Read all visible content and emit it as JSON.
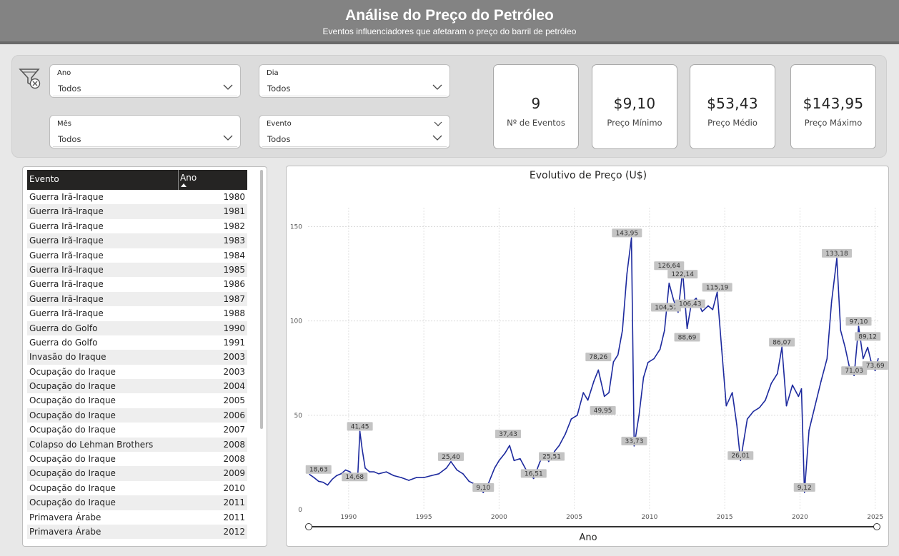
{
  "header": {
    "title": "Análise do Preço do Petróleo",
    "subtitle": "Eventos influenciadores que afetaram o preço do barril de petróleo"
  },
  "filters": {
    "ano": {
      "label": "Ano",
      "value": "Todos"
    },
    "dia": {
      "label": "Dia",
      "value": "Todos"
    },
    "mes": {
      "label": "Mês",
      "value": "Todos"
    },
    "evento": {
      "label": "Evento",
      "value": "Todos"
    }
  },
  "cards": [
    {
      "value": "9",
      "caption": "Nº de Eventos"
    },
    {
      "value": "$9,10",
      "caption": "Preço Mínimo"
    },
    {
      "value": "$53,43",
      "caption": "Preço Médio"
    },
    {
      "value": "$143,95",
      "caption": "Preço Máximo"
    }
  ],
  "table": {
    "headers": [
      "Evento",
      "Ano"
    ],
    "rows": [
      [
        "Guerra Irã-Iraque",
        "1980"
      ],
      [
        "Guerra Irã-Iraque",
        "1981"
      ],
      [
        "Guerra Irã-Iraque",
        "1982"
      ],
      [
        "Guerra Irã-Iraque",
        "1983"
      ],
      [
        "Guerra Irã-Iraque",
        "1984"
      ],
      [
        "Guerra Irã-Iraque",
        "1985"
      ],
      [
        "Guerra Irã-Iraque",
        "1986"
      ],
      [
        "Guerra Irã-Iraque",
        "1987"
      ],
      [
        "Guerra Irã-Iraque",
        "1988"
      ],
      [
        "Guerra do Golfo",
        "1990"
      ],
      [
        "Guerra do Golfo",
        "1991"
      ],
      [
        "Invasão do Iraque",
        "2003"
      ],
      [
        "Ocupação do Iraque",
        "2003"
      ],
      [
        "Ocupação do Iraque",
        "2004"
      ],
      [
        "Ocupação do Iraque",
        "2005"
      ],
      [
        "Ocupação do Iraque",
        "2006"
      ],
      [
        "Ocupação do Iraque",
        "2007"
      ],
      [
        "Colapso do Lehman Brothers",
        "2008"
      ],
      [
        "Ocupação do Iraque",
        "2008"
      ],
      [
        "Ocupação do Iraque",
        "2009"
      ],
      [
        "Ocupação do Iraque",
        "2010"
      ],
      [
        "Ocupação do Iraque",
        "2011"
      ],
      [
        "Primavera Árabe",
        "2011"
      ],
      [
        "Primavera Árabe",
        "2012"
      ]
    ]
  },
  "chart_data": {
    "type": "line",
    "title": "Evolutivo de Preço (U$)",
    "xlabel": "Ano",
    "ylabel": "",
    "xlim": [
      1987.3,
      2025.3
    ],
    "ylim": [
      0,
      160
    ],
    "x_ticks": [
      1990,
      1995,
      2000,
      2005,
      2010,
      2015,
      2020,
      2025
    ],
    "y_ticks": [
      0,
      50,
      100,
      150
    ],
    "grid": true,
    "color": "#1d2a9e",
    "series": [
      {
        "x": [
          1987.4,
          1987.7,
          1988.0,
          1988.3,
          1988.6,
          1988.9,
          1989.2,
          1989.5,
          1989.8,
          1990.1,
          1990.4,
          1990.6,
          1990.75,
          1990.9,
          1991.1,
          1991.4,
          1991.7,
          1992.0,
          1992.5,
          1993.0,
          1993.5,
          1994.0,
          1994.5,
          1995.0,
          1995.5,
          1996.0,
          1996.5,
          1996.8,
          1997.2,
          1997.6,
          1998.0,
          1998.5,
          1998.95,
          1999.3,
          1999.7,
          2000.0,
          2000.4,
          2000.7,
          2001.0,
          2001.4,
          2001.9,
          2002.3,
          2002.7,
          2003.0,
          2003.3,
          2003.7,
          2004.0,
          2004.4,
          2004.8,
          2005.2,
          2005.6,
          2005.9,
          2006.3,
          2006.6,
          2007.0,
          2007.3,
          2007.6,
          2007.9,
          2008.2,
          2008.5,
          2008.8,
          2008.98,
          2009.3,
          2009.6,
          2009.9,
          2010.3,
          2010.7,
          2011.0,
          2011.3,
          2011.6,
          2011.9,
          2012.2,
          2012.5,
          2012.8,
          2013.1,
          2013.5,
          2013.9,
          2014.2,
          2014.5,
          2014.8,
          2015.1,
          2015.5,
          2015.8,
          2016.05,
          2016.5,
          2016.9,
          2017.3,
          2017.7,
          2018.1,
          2018.5,
          2018.8,
          2019.1,
          2019.5,
          2019.9,
          2020.1,
          2020.3,
          2020.6,
          2021.0,
          2021.4,
          2021.8,
          2022.1,
          2022.45,
          2022.7,
          2023.0,
          2023.3,
          2023.6,
          2023.9,
          2024.2,
          2024.5,
          2024.8,
          2025.0,
          2025.2
        ],
        "y": [
          18.63,
          17,
          15,
          14.5,
          13,
          16,
          18,
          19,
          21,
          20,
          17,
          17,
          41.45,
          32,
          22,
          20,
          20,
          19,
          20,
          18,
          17,
          15.5,
          17,
          17,
          18,
          19,
          22,
          25.4,
          21,
          19,
          15,
          13,
          9.1,
          14,
          22,
          26,
          30,
          34,
          26,
          27,
          19.5,
          16.51,
          25,
          30,
          25.51,
          31,
          34,
          40,
          48,
          50,
          62,
          58,
          68,
          74,
          60,
          62,
          78.26,
          82,
          95,
          125,
          143.95,
          33.73,
          50,
          70,
          78,
          80,
          85,
          95,
          120,
          111,
          104.57,
          126.64,
          96,
          110,
          112,
          105,
          108,
          106,
          115.19,
          85,
          55,
          62,
          45,
          26.01,
          48,
          52,
          54,
          58,
          67,
          72,
          86.07,
          55,
          66,
          60,
          64,
          9.12,
          42,
          55,
          68,
          80,
          110,
          133.18,
          95,
          86,
          75,
          71.03,
          97.1,
          80,
          86,
          76,
          73.69,
          80
        ]
      }
    ],
    "labels": [
      {
        "x": 1988.0,
        "y": 18.63,
        "text": "18,63"
      },
      {
        "x": 1990.75,
        "y": 41.45,
        "text": "41,45"
      },
      {
        "x": 1990.4,
        "y": 14.68,
        "text": "14,68"
      },
      {
        "x": 1996.8,
        "y": 25.4,
        "text": "25,40"
      },
      {
        "x": 1998.95,
        "y": 9.1,
        "text": "9,10"
      },
      {
        "x": 2000.6,
        "y": 37.43,
        "text": "37,43"
      },
      {
        "x": 2002.3,
        "y": 16.51,
        "text": "16,51"
      },
      {
        "x": 2003.5,
        "y": 25.51,
        "text": "25,51"
      },
      {
        "x": 2006.6,
        "y": 78.26,
        "text": "78,26"
      },
      {
        "x": 2006.9,
        "y": 49.95,
        "text": "49,95"
      },
      {
        "x": 2008.5,
        "y": 143.95,
        "text": "143,95"
      },
      {
        "x": 2008.98,
        "y": 33.73,
        "text": "33,73"
      },
      {
        "x": 2011.3,
        "y": 126.64,
        "text": "126,64"
      },
      {
        "x": 2011.1,
        "y": 104.57,
        "text": "104,57"
      },
      {
        "x": 2012.2,
        "y": 122.14,
        "text": "122,14"
      },
      {
        "x": 2012.7,
        "y": 106.43,
        "text": "106,43"
      },
      {
        "x": 2012.5,
        "y": 88.69,
        "text": "88,69"
      },
      {
        "x": 2014.5,
        "y": 115.19,
        "text": "115,19"
      },
      {
        "x": 2016.05,
        "y": 26.01,
        "text": "26,01"
      },
      {
        "x": 2018.8,
        "y": 86.07,
        "text": "86,07"
      },
      {
        "x": 2020.3,
        "y": 9.12,
        "text": "9,12"
      },
      {
        "x": 2022.45,
        "y": 133.18,
        "text": "133,18"
      },
      {
        "x": 2023.9,
        "y": 97.1,
        "text": "97,10"
      },
      {
        "x": 2024.5,
        "y": 89.12,
        "text": "89,12"
      },
      {
        "x": 2023.6,
        "y": 71.03,
        "text": "71,03"
      },
      {
        "x": 2025.0,
        "y": 73.69,
        "text": "73,69"
      }
    ]
  }
}
